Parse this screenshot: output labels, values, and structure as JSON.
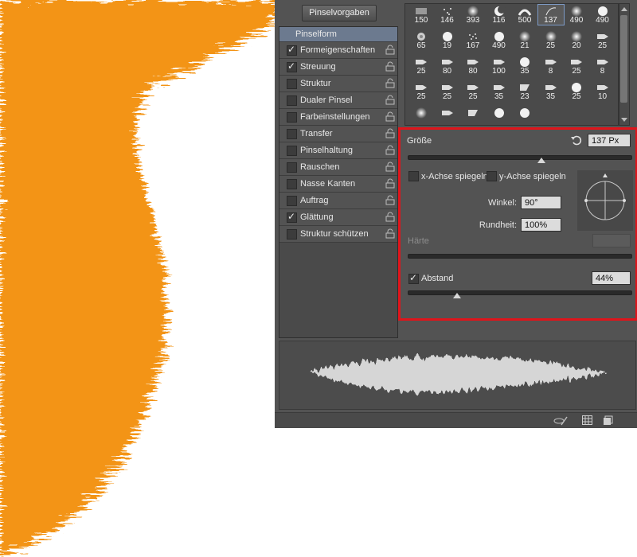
{
  "panel": {
    "presets_button": "Pinselvorgaben"
  },
  "list": {
    "header": "Pinselform",
    "items": [
      {
        "label": "Formeigenschaften",
        "checked": true
      },
      {
        "label": "Streuung",
        "checked": true
      },
      {
        "label": "Struktur",
        "checked": false
      },
      {
        "label": "Dualer Pinsel",
        "checked": false
      },
      {
        "label": "Farbeinstellungen",
        "checked": false
      },
      {
        "label": "Transfer",
        "checked": false
      },
      {
        "label": "Pinselhaltung",
        "checked": false
      },
      {
        "label": "Rauschen",
        "checked": false
      },
      {
        "label": "Nasse Kanten",
        "checked": false
      },
      {
        "label": "Auftrag",
        "checked": false
      },
      {
        "label": "Glättung",
        "checked": true
      },
      {
        "label": "Struktur schützen",
        "checked": false
      }
    ]
  },
  "brush_tips": {
    "sizes": [
      "150",
      "146",
      "393",
      "116",
      "500",
      "137",
      "490",
      "490",
      "65",
      "19",
      "167",
      "490",
      "21",
      "25",
      "20",
      "25",
      "25",
      "80",
      "80",
      "100",
      "35",
      "8",
      "25",
      "8",
      "25",
      "25",
      "25",
      "35",
      "23",
      "35",
      "25",
      "10"
    ],
    "selected": "137"
  },
  "settings": {
    "size_label": "Größe",
    "size_value": "137 Px",
    "size_level": 0.6,
    "flip_x_label": "x-Achse spiegeln",
    "flip_y_label": "y-Achse spiegeln",
    "angle_label": "Winkel:",
    "angle_value": "90°",
    "roundness_label": "Rundheit:",
    "roundness_value": "100%",
    "hardness_label": "Härte",
    "spacing_label": "Abstand",
    "spacing_value": "44%",
    "spacing_checked": true
  },
  "colors": {
    "highlight": "#e0141b",
    "fur": "#f39419",
    "panel": "#535353"
  }
}
